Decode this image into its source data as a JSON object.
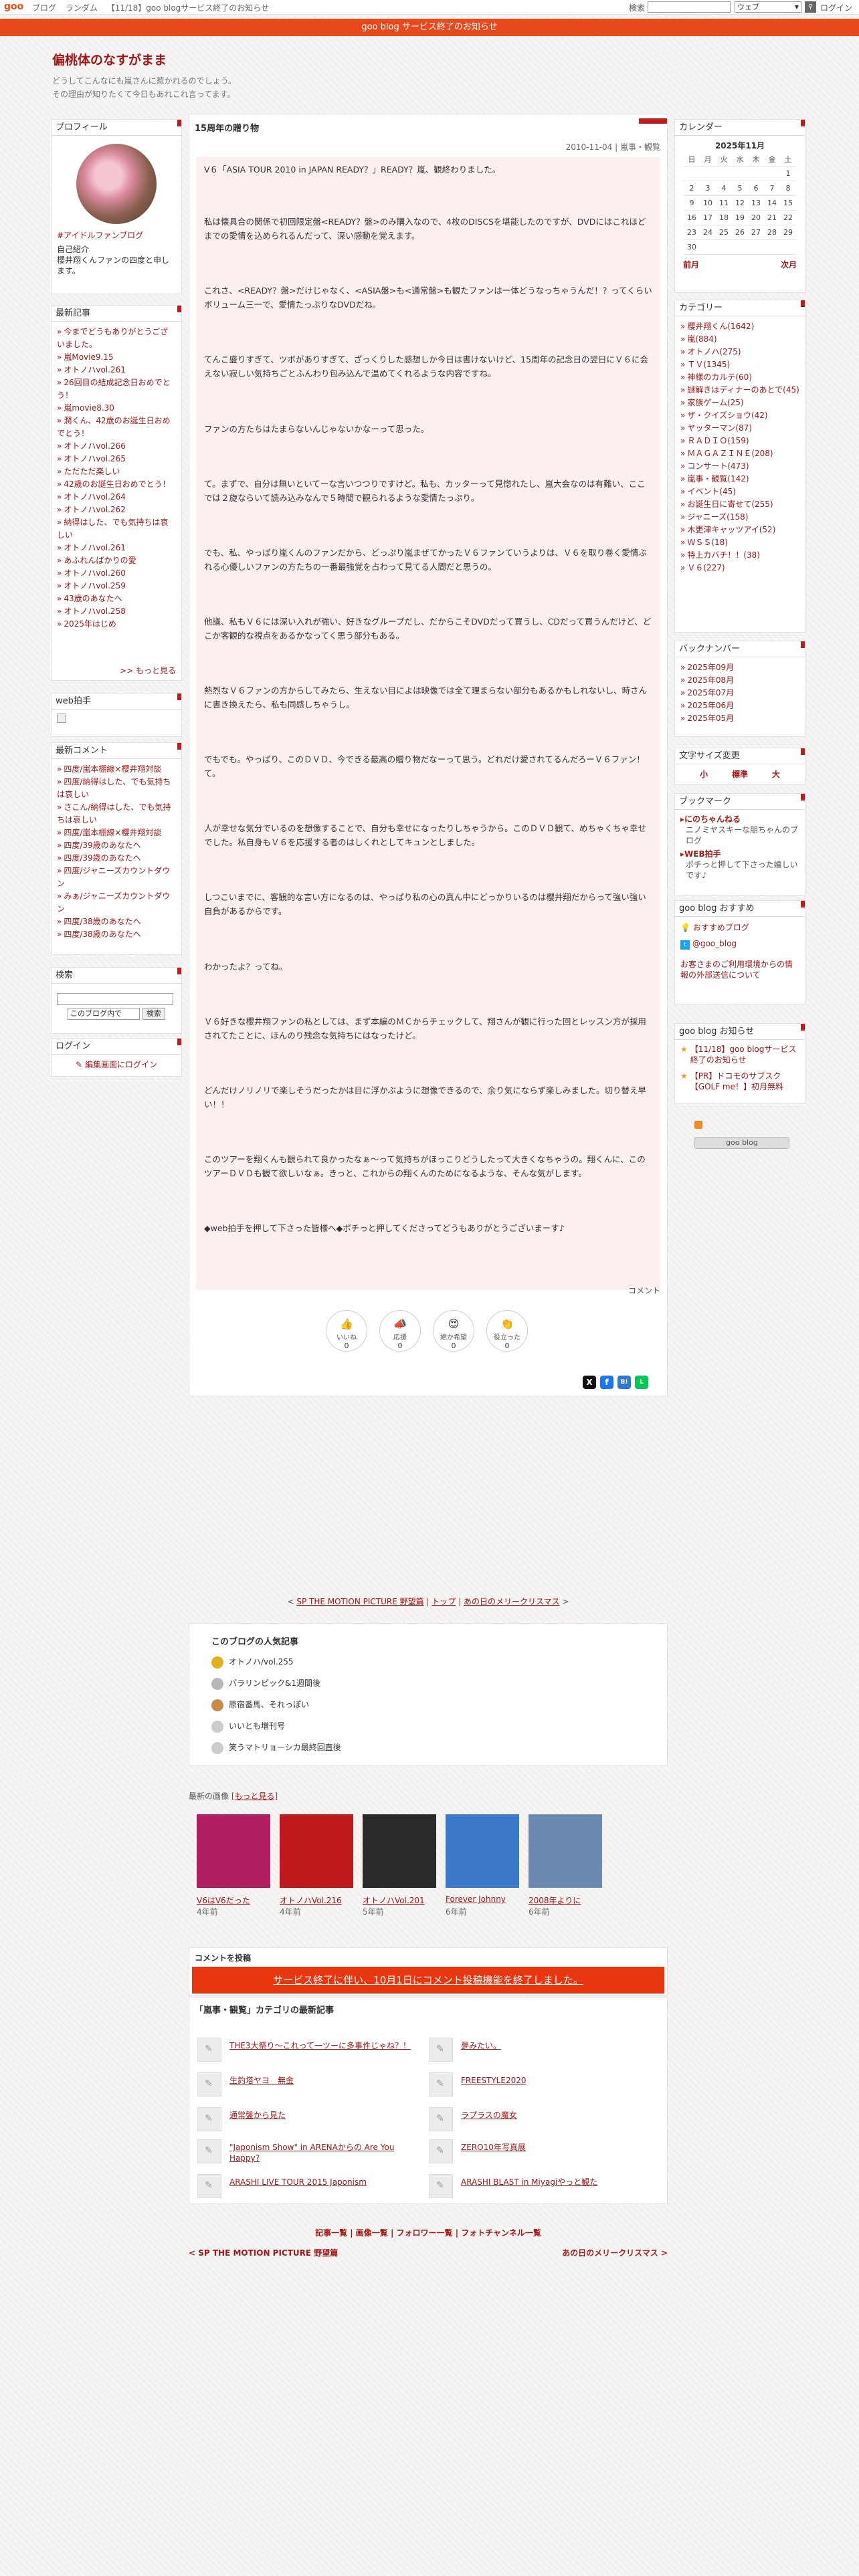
{
  "topbar": {
    "logo": "goo",
    "links": [
      "ブログ",
      "ランダム",
      "【11/18】goo blogサービス終了のお知らせ"
    ],
    "search_label": "検索",
    "search_scope": "ウェブ",
    "login": "ログイン"
  },
  "notice": "goo blog サービス終了のお知らせ",
  "blog": {
    "title": "偏桃体のなすがまま",
    "desc1": "どうしてこんなにも嵐さんに惹かれるのでしょう。",
    "desc2": "その理由が知りたくて今日もあれこれ言ってます。"
  },
  "profile": {
    "heading": "プロフィール",
    "name": "#アイドルファンブログ",
    "intro_heading": "自己紹介",
    "intro": "櫻井翔くんファンの四度と申します。"
  },
  "recent": {
    "heading": "最新記事",
    "items": [
      "今までどうもありがとうございました。",
      "嵐Movie9.15",
      "オトノハvol.261",
      "26回目の結成記念日おめでとう！",
      "嵐movie8.30",
      "潤くん、42歳のお誕生日おめでとう！",
      "オトノハvol.266",
      "オトノハvol.265",
      "ただただ楽しい",
      "42歳のお誕生日おめでとう！",
      "オトノハvol.264",
      "オトノハvol.262",
      "納得はした、でも気持ちは哀しい",
      "オトノハvol.261",
      "あふれんばかりの愛",
      "オトノハvol.260",
      "オトノハvol.259",
      "43歳のあなたへ",
      "オトノハvol.258",
      "2025年はじめ"
    ],
    "more": ">> もっと見る"
  },
  "webclap": {
    "heading": "web拍手"
  },
  "comments": {
    "heading": "最新コメント",
    "items": [
      "四度/嵐本棚線×櫻井翔対談",
      "四度/納得はした、でも気持ちは哀しい",
      "さこん/納得はした、でも気持ちは哀しい",
      "四度/嵐本棚線×櫻井翔対談",
      "四度/39歳のあなたへ",
      "四度/39歳のあなたへ",
      "四度/ジャニーズカウントダウン",
      "みぁ/ジャニーズカウントダウン",
      "四度/38歳のあなたへ",
      "四度/38歳のあなたへ"
    ]
  },
  "search": {
    "heading": "検索",
    "scope": "このブログ内で",
    "button": "検索"
  },
  "login_box": {
    "heading": "ログイン",
    "link": "編集画面にログイン"
  },
  "entry": {
    "title": "15周年の贈り物",
    "meta": "2010-11-04 | 嵐事・観覧",
    "paragraphs": [
      "V６「ASIA TOUR 2010 in JAPAN READY？」READY？嵐、観終わりました。",
      "私は懐具合の関係で初回限定盤<READY？盤>のみ購入なので、4枚のDISCSを堪能したのですが、DVDにはこれほどまでの愛情を込められるんだって、深い感動を覚えます。",
      "これさ、<READY？盤>だけじゃなく、<ASIA盤>も<通常盤>も観たファンは一体どうなっちゃうんだ！？ってくらいボリューム三一で、愛情たっぷりなDVDだね。",
      "てんこ盛りすぎて、ツボがありすぎて、ざっくりした感想しか今日は書けないけど、15周年の記念日の翌日にＶ６に会えない寂しい気持ちごとふんわり包み込んで温めてくれるような内容ですね。",
      "ファンの方たちはたまらないんじゃないかなーって思った。",
      "て。まずで、自分は無いといてーな言いつつりですけど。私も、カッターって見惚れたし、嵐大会なのは有難い、ここでは２旋ならいて読み込みなんで５時間で観られるような愛情たっぷり。",
      "でも、私、やっぱり嵐くんのファンだから、どっぷり嵐まぜてかったＶ６ファンていうよりは、Ｖ６を取り巻く愛情ぶれる心優しいファンの方たちの一番最強覚を占わって見てる人間だと思うの。",
      "他議、私もＶ６には深い入れが強い、好きなグループだし、だからこそDVDだって買うし、CDだって買うんだけど、どこか客観的な視点をあるかなってく思う部分もある。",
      "熱烈なＶ６ファンの方からしてみたら、生えない目によは映像では全て理まらない部分もあるかもしれないし、時さんに書き換えたら、私も同感しちゃうし。",
      "でもでも。やっぱり、このＤＶＤ、今できる最高の贈り物だなーって思う。どれだけ愛されてるんだろーＶ６ファン！て。",
      "人が幸せな気分でいるのを想像することで、自分も幸せになったりしちゃうから。このＤＶＤ観て、めちゃくちゃ幸せでした。私自身もＶ６を応援する者のはしくれとしてキュンとしました。",
      "しつこいまでに、客観的な言い方になるのは、やっぱり私の心の真ん中にどっかりいるのは櫻井翔だからって強い強い自負があるからです。",
      "わかったよ？ってね。",
      "Ｖ６好きな櫻井翔ファンの私としては、まず本編のＭＣからチェックして、翔さんが観に行った回とレッスン方が採用されてたことに、ほんのり残念な気持ちにはなったけど。",
      "どんだけノリノリで楽しそうだったかは目に浮かぶように想像できるので、余り気にならず楽しみました。切り替え早い！！",
      "このツアーを翔くんも観られて良かったなぁ～って気持ちがほっこりどうしたって大きくなちゃうの。翔くんに、このツアーＤＶＤも観て欲しいなぁ。きっと、これからの翔くんのためになるような、そんな気がします。",
      "◆web拍手を押して下さった皆様へ◆ポチっと押してくださってどうもありがとうございまーす♪"
    ],
    "comment_link": "コメント",
    "reactions": [
      {
        "top": "すごい",
        "label": "いいね",
        "count": "0"
      },
      {
        "top": "マッシー",
        "label": "応援",
        "count": "0"
      },
      {
        "top": "ナイス",
        "label": "絶か希望",
        "count": "0"
      },
      {
        "top": "ありがとう",
        "label": "役立った",
        "count": "0"
      }
    ]
  },
  "pager": {
    "prev": "SP THE MOTION PICTURE 野望篇",
    "top": "トップ",
    "next": "あの日のメリークリスマス"
  },
  "popular": {
    "heading": "このブログの人気記事",
    "items": [
      "オトノハ/vol.255",
      "パラリンピック&1週間後",
      "原宿番馬、それっぽい",
      "いいとも増刊号",
      "笑うマトリョーシカ最終回直後"
    ]
  },
  "images": {
    "heading": "最新の画像",
    "more": "もっと見る",
    "items": [
      {
        "title": "V6はV6だった",
        "ago": "4年前",
        "color": "#b02060"
      },
      {
        "title": "オトノハVol.216",
        "ago": "4年前",
        "color": "#c0181c"
      },
      {
        "title": "オトノハVol.201",
        "ago": "5年前",
        "color": "#2a2a2a"
      },
      {
        "title": "Forever Johnny",
        "ago": "6年前",
        "color": "#3c78c8"
      },
      {
        "title": "2008年よりに",
        "ago": "6年前",
        "color": "#6a8ab0"
      }
    ]
  },
  "comment_post": {
    "heading": "コメントを投稿",
    "notice": "サービス終了に伴い、10月1日にコメント投稿機能を終了しました。"
  },
  "category": {
    "heading": "「嵐事・観覧」カテゴリの最新記事",
    "left": [
      "THE3大祭り～これって一ツーに多事件じゃね？！",
      "生釣塔ヤヨ　無金",
      "通常盤から見た",
      "\"Japonism Show\" in ARENAからの Are You Happy?",
      "ARASHI LIVE TOUR 2015 Japonism"
    ],
    "right": [
      "夢みたい。",
      "FREESTYLE2020",
      "ラプラスの魔女",
      "ZERO10年写真展",
      "ARASHI BLAST in Miyagiやっと観た"
    ]
  },
  "footer": {
    "links": "記事一覧 | 画像一覧 | フォロワー一覧 | フォトチャンネル一覧",
    "prev": "< SP THE MOTION PICTURE 野望篇",
    "next": "あの日のメリークリスマス >"
  },
  "calendar": {
    "heading": "カレンダー",
    "month": "2025年11月",
    "weekdays": [
      "日",
      "月",
      "火",
      "水",
      "木",
      "金",
      "土"
    ],
    "prev": "前月",
    "next": "次月",
    "rows": [
      [
        "",
        "",
        "",
        "",
        "",
        "",
        "1"
      ],
      [
        "2",
        "3",
        "4",
        "5",
        "6",
        "7",
        "8"
      ],
      [
        "9",
        "10",
        "11",
        "12",
        "13",
        "14",
        "15"
      ],
      [
        "16",
        "17",
        "18",
        "19",
        "20",
        "21",
        "22"
      ],
      [
        "23",
        "24",
        "25",
        "26",
        "27",
        "28",
        "29"
      ],
      [
        "30",
        "",
        "",
        "",
        "",
        "",
        ""
      ]
    ]
  },
  "categories": {
    "heading": "カテゴリー",
    "items": [
      "櫻井翔くん(1642)",
      "嵐(884)",
      "オトノハ(275)",
      "ＴＶ(1345)",
      "神様のカルテ(60)",
      "謎解きはディナーのあとで(45)",
      "家族ゲーム(25)",
      "ザ・クイズショウ(42)",
      "ヤッターマン(87)",
      "ＲＡＤＩＯ(159)",
      "ＭＡＧＡＺＩＮＥ(208)",
      "コンサート(473)",
      "嵐事・観覧(142)",
      "イベント(45)",
      "お誕生日に寄せて(255)",
      "ジャニーズ(158)",
      "木更津キャッツアイ(52)",
      "ＷＳＳ(18)",
      "特上カバチ！！(38)",
      "Ｖ６(227)"
    ]
  },
  "backnumber": {
    "heading": "バックナンバー",
    "items": [
      "2025年09月",
      "2025年08月",
      "2025年07月",
      "2025年06月",
      "2025年05月"
    ]
  },
  "fontsize": {
    "heading": "文字サイズ変更",
    "small": "小",
    "medium": "標準",
    "large": "大"
  },
  "bookmark": {
    "heading": "ブックマーク",
    "b1_title": "にのちゃんねる",
    "b1_desc": "ニノミヤスキーな朋ちゃんのブログ",
    "b2_title": "WEB拍手",
    "b2_desc": "ポチっと押して下さった嬉しいです♪"
  },
  "goo_recommend": {
    "heading": "goo blog おすすめ",
    "item1": "おすすめブログ",
    "item2": "@goo_blog",
    "note": "お客さまのご利用環境からの情報の外部送信について"
  },
  "goo_notice": {
    "heading": "goo blog お知らせ",
    "item1": "【11/18】goo blogサービス終了のお知らせ",
    "item2": "【PR】ドコモのサブスク【GOLF me！】初月無料"
  },
  "goo_badge": "goo blog"
}
